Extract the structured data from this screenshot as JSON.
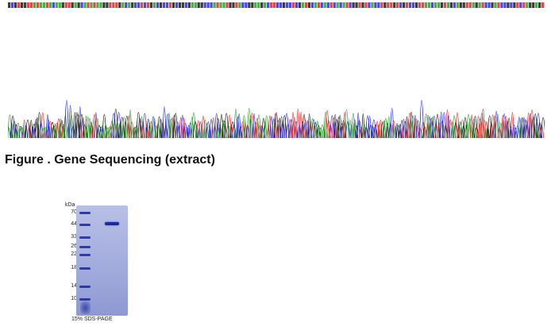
{
  "figure": {
    "caption": "Figure . Gene Sequencing (extract)"
  },
  "gel": {
    "unit_label": "kDa",
    "markers": [
      "70",
      "44",
      "33",
      "26",
      "22",
      "18",
      "14",
      "10"
    ],
    "caption": "15% SDS-PAGE"
  },
  "colors": {
    "base_a": "#2a9d2a",
    "base_c": "#2a2ad6",
    "base_g": "#1a1a1a",
    "base_t": "#d62a2a",
    "gel_lane": "#2a3599"
  }
}
